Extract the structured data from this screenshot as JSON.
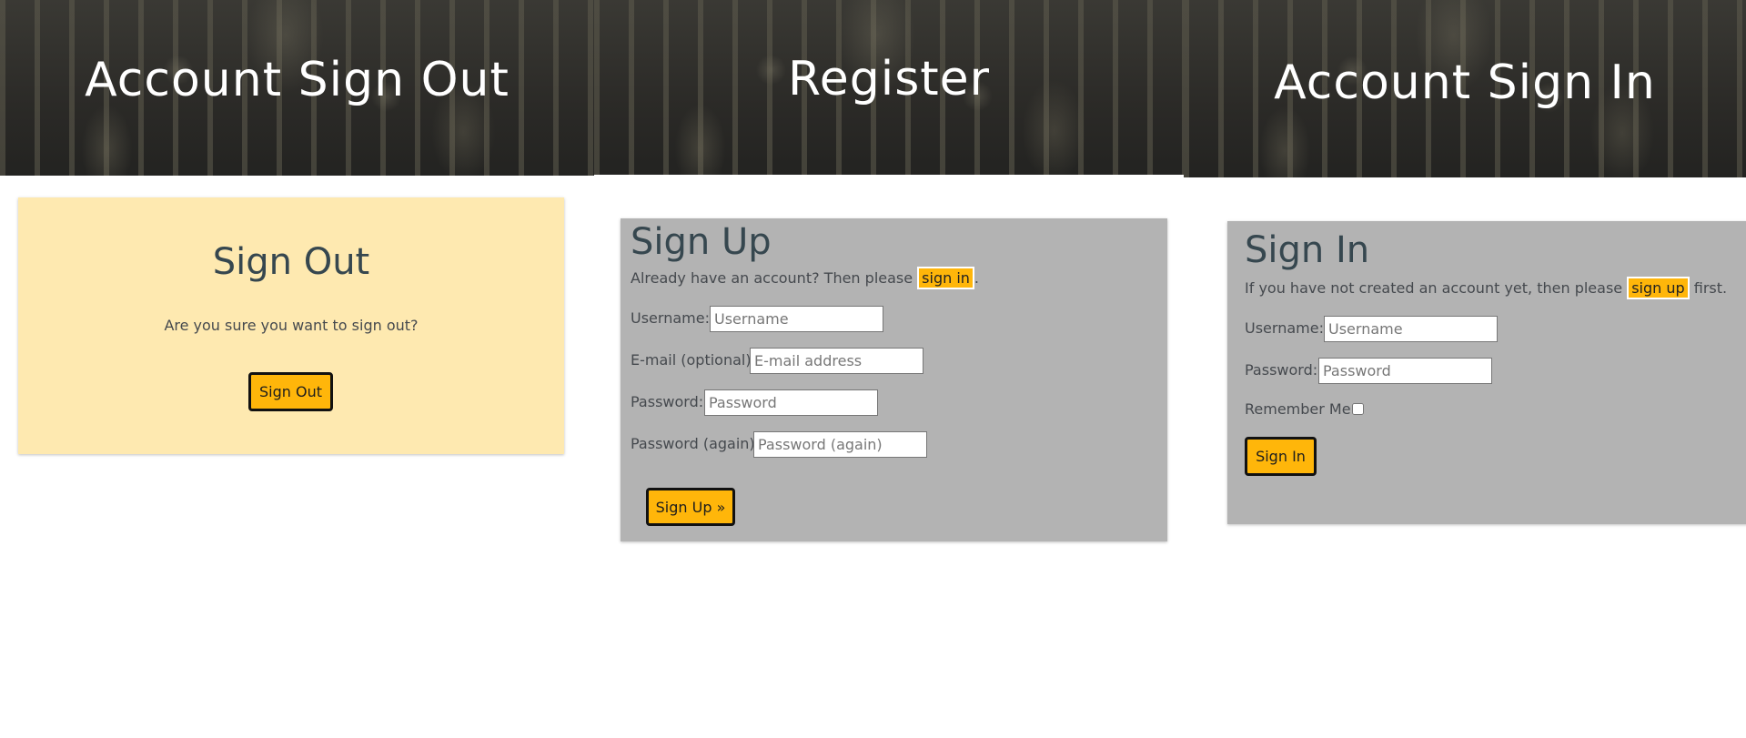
{
  "signout": {
    "hero_title": "Account Sign Out",
    "heading": "Sign Out",
    "message": "Are you sure you want to sign out?",
    "button_label": "Sign Out"
  },
  "register": {
    "hero_title": "Register",
    "heading": "Sign Up",
    "intro_before": "Already have an account? Then please ",
    "intro_link": "sign in",
    "intro_after": ".",
    "fields": {
      "username_label": "Username:",
      "username_placeholder": "Username",
      "email_label": "E-mail (optional):",
      "email_placeholder": "E-mail address",
      "password_label": "Password:",
      "password_placeholder": "Password",
      "password2_label": "Password (again):",
      "password2_placeholder": "Password (again)"
    },
    "button_label": "Sign Up »"
  },
  "signin": {
    "hero_title": "Account Sign In",
    "heading": "Sign In",
    "intro_before": "If you have not created an account yet, then please ",
    "intro_link": "sign up",
    "intro_after": " first.",
    "fields": {
      "username_label": "Username:",
      "username_placeholder": "Username",
      "password_label": "Password:",
      "password_placeholder": "Password",
      "remember_label": "Remember Me:"
    },
    "remember_checked": false,
    "button_label": "Sign In"
  },
  "colors": {
    "accent": "#ffb60a",
    "signout_card_bg": "#fee9b0",
    "form_card_bg": "#b3b3b3",
    "heading_text": "#36474f"
  }
}
